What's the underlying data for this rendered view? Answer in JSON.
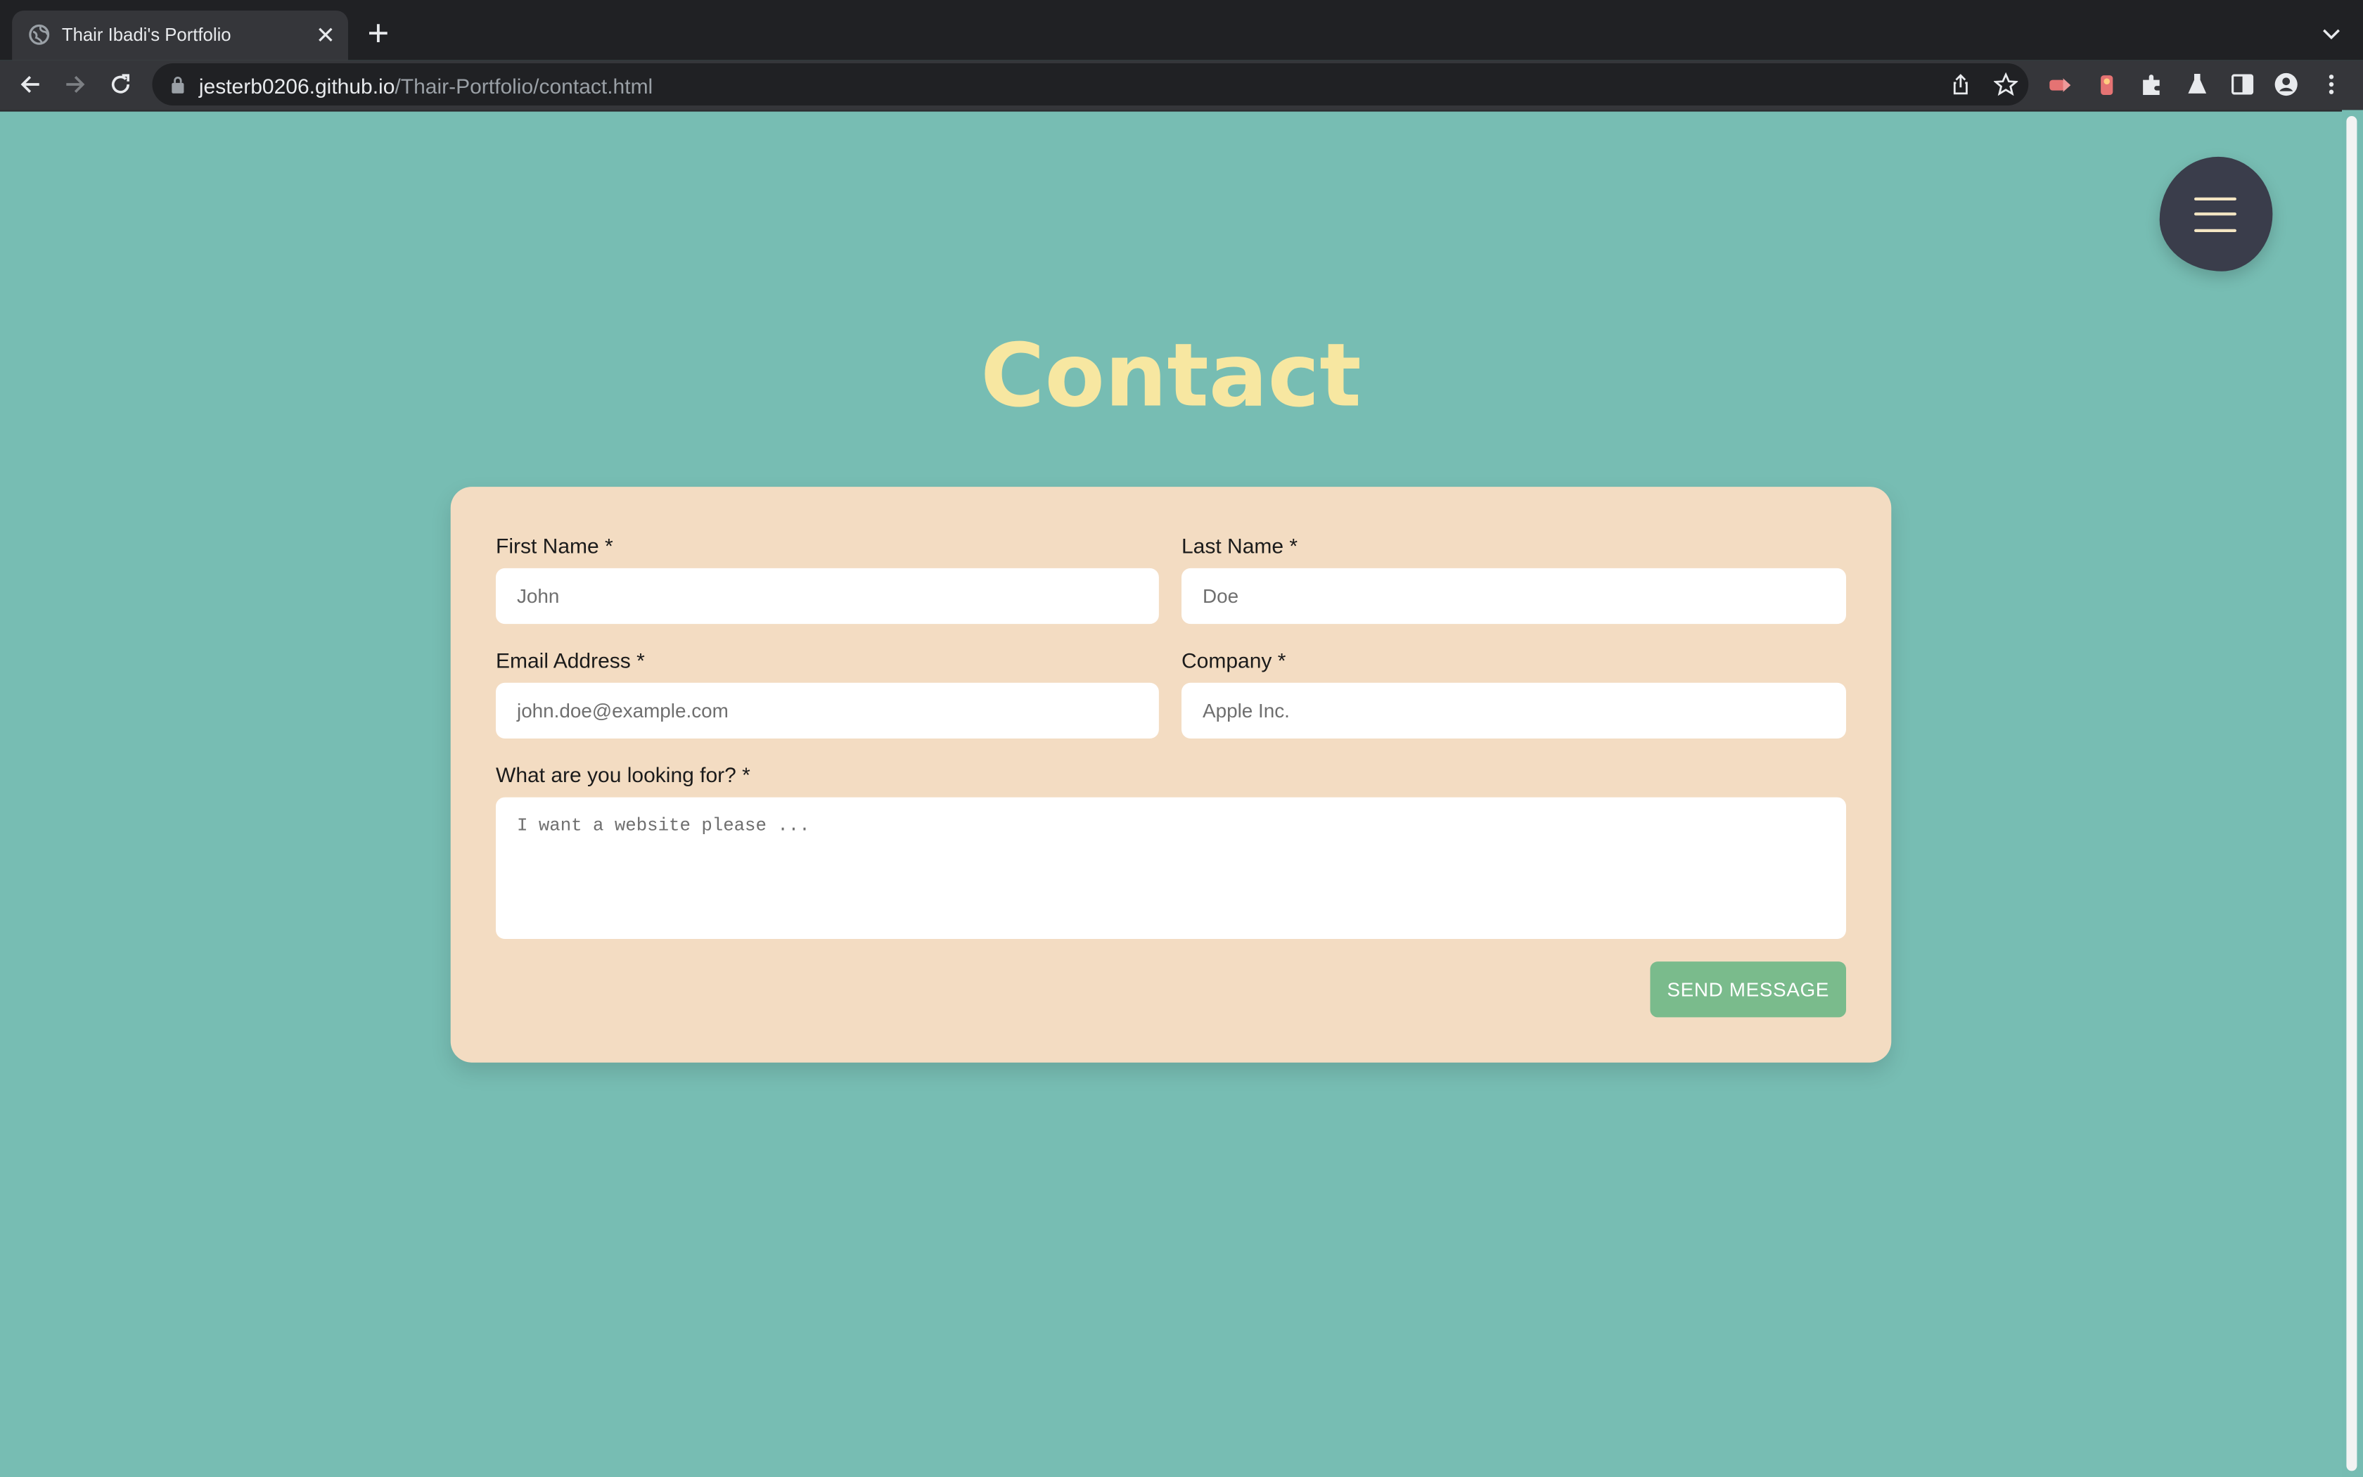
{
  "browser": {
    "tab_title": "Thair Ibadi's Portfolio",
    "url_host": "jesterb0206.github.io",
    "url_path": "/Thair-Portfolio/contact.html"
  },
  "page": {
    "title": "Contact",
    "menu_icon": "hamburger-menu-icon"
  },
  "form": {
    "first_name": {
      "label": "First Name *",
      "placeholder": "John"
    },
    "last_name": {
      "label": "Last Name *",
      "placeholder": "Doe"
    },
    "email": {
      "label": "Email Address *",
      "placeholder": "john.doe@example.com"
    },
    "company": {
      "label": "Company *",
      "placeholder": "Apple Inc."
    },
    "message": {
      "label": "What are you looking for? *",
      "placeholder": "I want a website please ..."
    },
    "submit_label": "SEND MESSAGE"
  },
  "colors": {
    "background": "#77bdb3",
    "title": "#f7e7a1",
    "card": "#f3dcc2",
    "button": "#7abb8c",
    "menu": "#3a3d4b"
  }
}
